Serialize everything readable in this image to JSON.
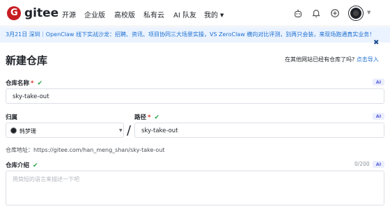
{
  "nav": {
    "brand": "gitee",
    "links": [
      "开源",
      "企业版",
      "高校版",
      "私有云",
      "AI 队友",
      "我的"
    ]
  },
  "announcement": "3月21日 深圳｜OpenClaw 线下实战沙龙：招聘、资讯、项目协同三大场景实操，VS ZeroClaw 横向对比评测，别再只会装，来现场跑通真实业务！",
  "page": {
    "title": "新建仓库",
    "import_hint": "在其他网站已经有仓库了吗?",
    "import_link": "点击导入"
  },
  "form": {
    "repo_name_label": "仓库名称",
    "repo_name_value": "sky-take-out",
    "owner_label": "归属",
    "owner_value": "韩梦珊",
    "path_label": "路径",
    "path_value": "sky-take-out",
    "address_text": "仓库地址：https://gitee.com/han_meng_shan/sky-take-out",
    "desc_label": "仓库介绍",
    "desc_counter": "0/200",
    "desc_placeholder": "用简短的语言来描述一下吧",
    "ai_label": "AI",
    "required_mark": "*",
    "check_mark": "✔"
  },
  "colors": {
    "brand": "#c71d23",
    "link": "#1d6fd1",
    "success": "#2aa64a",
    "required": "#e0332c"
  }
}
